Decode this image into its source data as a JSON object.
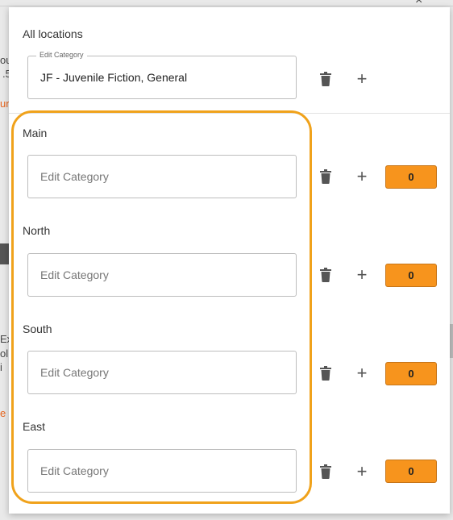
{
  "background": {
    "fragments": [
      "ou",
      ".5",
      "ur",
      "Ex",
      "ol",
      " i",
      "e"
    ],
    "close_mark": "×"
  },
  "panel": {
    "all_locations": {
      "title": "All locations",
      "field_legend": "Edit Category",
      "field_value": "JF - Juvenile Fiction, General"
    },
    "locations": [
      {
        "name": "Main",
        "placeholder": "Edit Category",
        "count": "0"
      },
      {
        "name": "North",
        "placeholder": "Edit Category",
        "count": "0"
      },
      {
        "name": "South",
        "placeholder": "Edit Category",
        "count": "0"
      },
      {
        "name": "East",
        "placeholder": "Edit Category",
        "count": "0"
      }
    ],
    "icons": {
      "delete": "trash-icon",
      "add": "plus-icon"
    },
    "colors": {
      "count_badge": "#f7941d",
      "highlight": "#f0a21b"
    }
  }
}
